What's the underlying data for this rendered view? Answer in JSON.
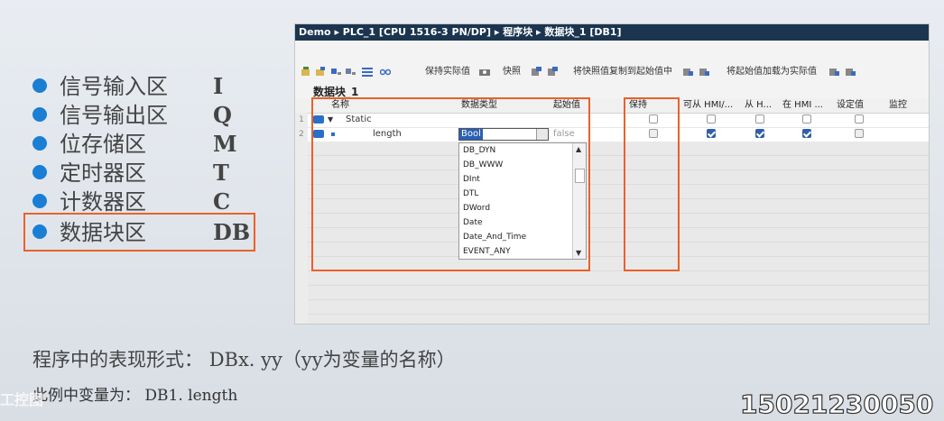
{
  "bullets": [
    {
      "name": "信号输入区",
      "code": "I"
    },
    {
      "name": "信号输出区",
      "code": "Q"
    },
    {
      "name": "位存储区",
      "code": "M"
    },
    {
      "name": "定时器区",
      "code": "T"
    },
    {
      "name": "计数器区",
      "code": "C"
    },
    {
      "name": "数据块区",
      "code": "DB"
    }
  ],
  "editor": {
    "breadcrumb": "Demo ▸ PLC_1 [CPU 1516-3 PN/DP] ▸ 程序块 ▸ 数据块_1 [DB1]",
    "toolbar": {
      "keep_actual": "保持实际值",
      "snapshot": "快照",
      "copy_snapshot": "将快照值复制到起始值中",
      "load_start": "将起始值加载为实际值"
    },
    "block_name": "数据块_1",
    "columns": {
      "name": "名称",
      "datatype": "数据类型",
      "start": "起始值",
      "retain": "保持",
      "hmi_access": "可从 HMI/...",
      "hmi_from": "从 H...",
      "hmi_in": "在 HMI ...",
      "setpoint": "设定值",
      "monitor": "监控"
    },
    "rows": [
      {
        "num": "1",
        "name": "Static",
        "datatype": "",
        "start": ""
      },
      {
        "num": "2",
        "name": "length",
        "datatype": "Bool",
        "start": "false"
      }
    ],
    "dropdown_items": [
      "DB_DYN",
      "DB_WWW",
      "DInt",
      "DTL",
      "DWord",
      "Date",
      "Date_And_Time",
      "EVENT_ANY"
    ]
  },
  "captions": {
    "line1_label": "程序中的表现形式：",
    "line1_value": "DBx. yy（yy为变量的名称）",
    "line2_label": "此例中变量为：",
    "line2_value": "DB1. length"
  },
  "watermark": "工控图",
  "phone": "15021230050",
  "colors": {
    "accent_box": "#e8622a",
    "bullet": "#1a7fd4",
    "titlebar": "#1b3550"
  }
}
